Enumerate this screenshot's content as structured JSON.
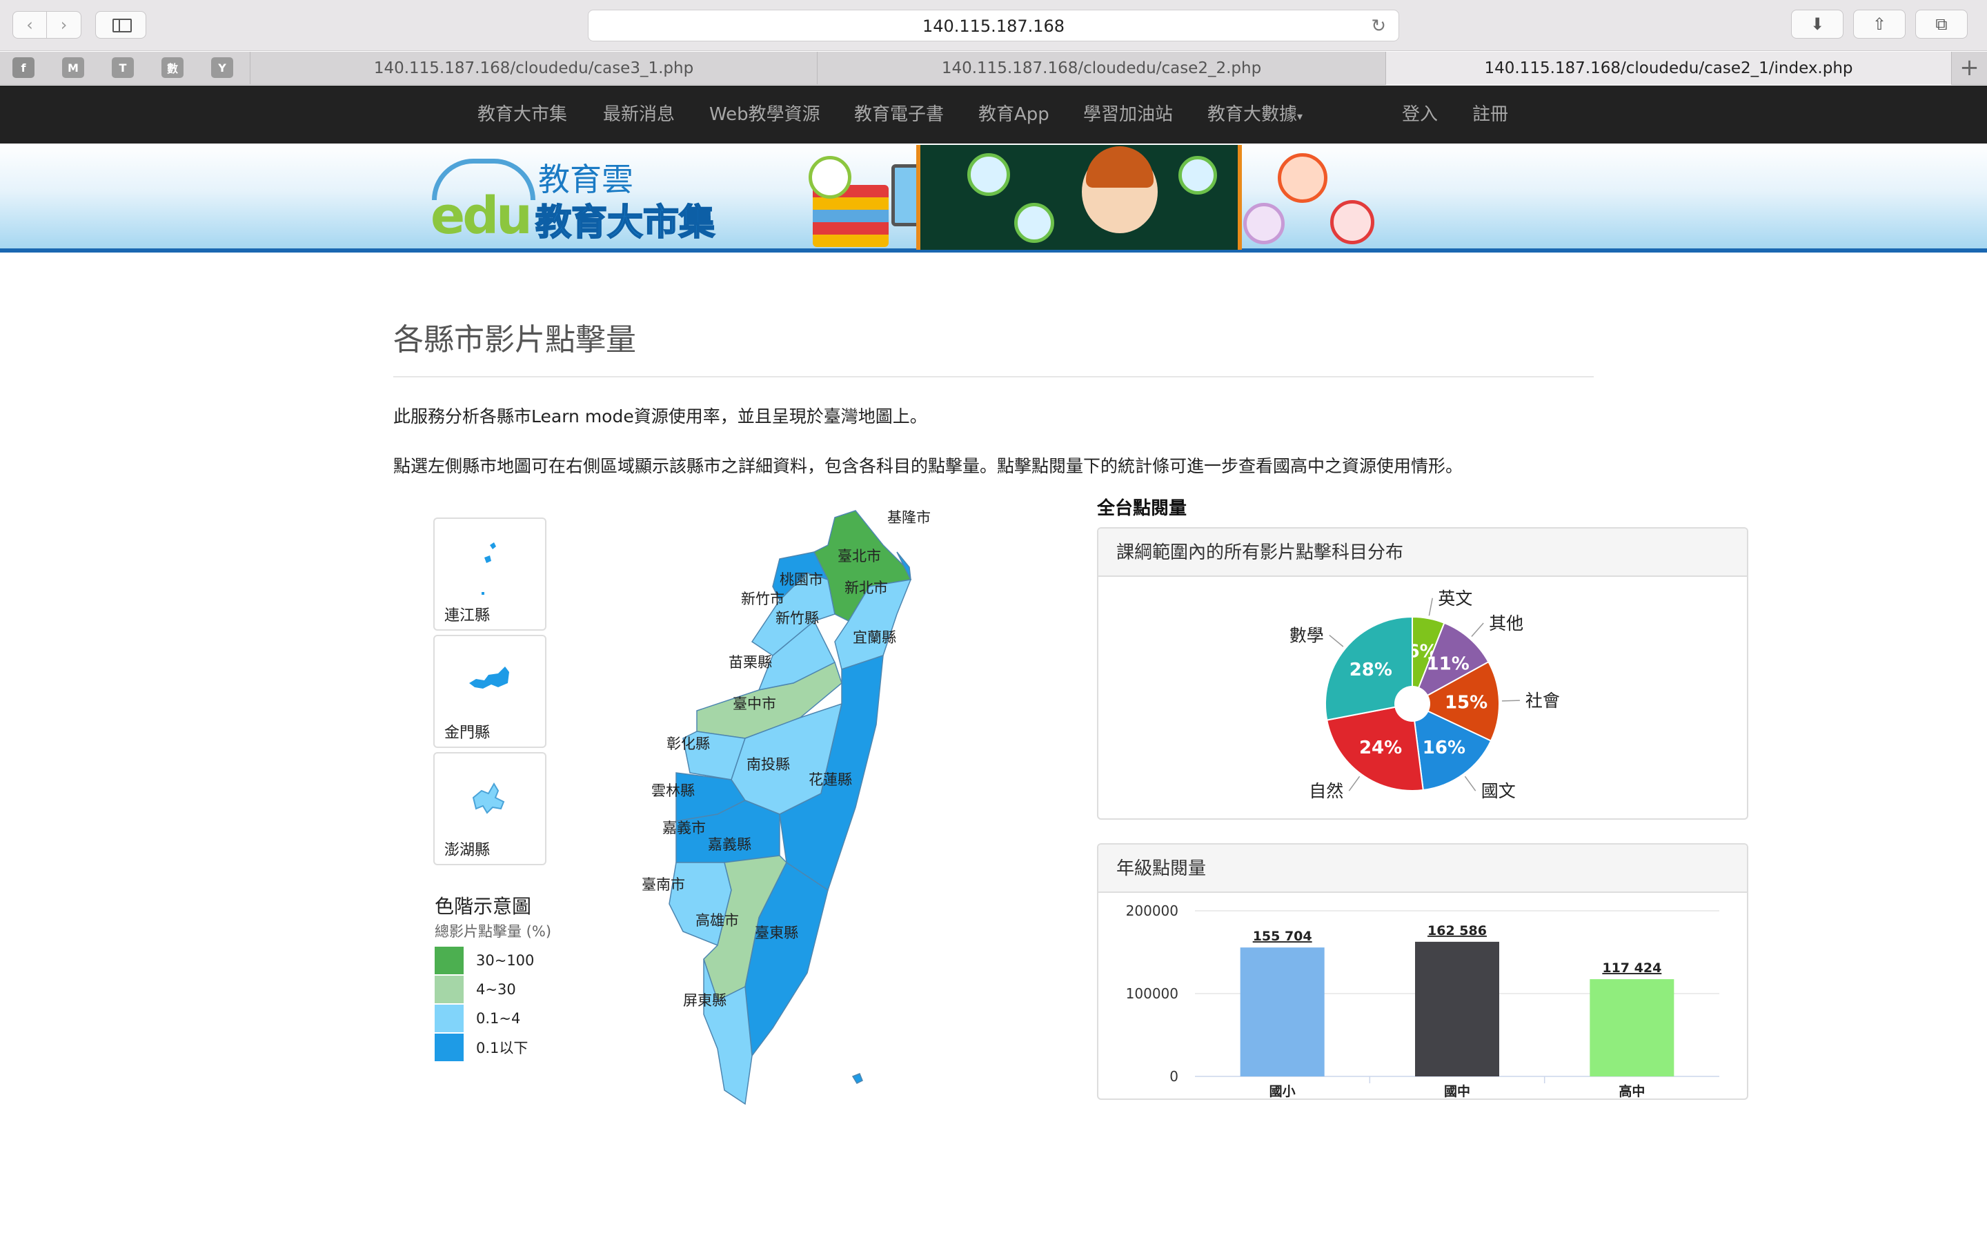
{
  "browser": {
    "address": "140.115.187.168",
    "back_icon": "chevron-left-icon",
    "forward_icon": "chevron-right-icon",
    "favorites": [
      "f",
      "M",
      "T",
      "數",
      "Y"
    ],
    "tabs": [
      {
        "title": "140.115.187.168/cloudedu/case3_1.php",
        "active": false
      },
      {
        "title": "140.115.187.168/cloudedu/case2_2.php",
        "active": false
      },
      {
        "title": "140.115.187.168/cloudedu/case2_1/index.php",
        "active": true
      }
    ],
    "add_tab": "+"
  },
  "site_nav": {
    "items": [
      "教育大市集",
      "最新消息",
      "Web教學資源",
      "教育電子書",
      "教育App",
      "學習加油站",
      "教育大數據"
    ],
    "login": "登入",
    "register": "註冊"
  },
  "banner": {
    "logo_edu": "edu",
    "logo_title1": "教育雲",
    "logo_title2": "教育大市集"
  },
  "page": {
    "title": "各縣市影片點擊量",
    "para1": "此服務分析各縣市Learn mode資源使用率，並且呈現於臺灣地圖上。",
    "para2": "點選左側縣市地圖可在右側區域顯示該縣市之詳細資料，包含各科目的點擊量。點擊點閱量下的統計條可進一步查看國高中之資源使用情形。"
  },
  "map": {
    "islands": [
      "連江縣",
      "金門縣",
      "澎湖縣"
    ],
    "counties": [
      "基隆市",
      "臺北市",
      "桃園市",
      "新北市",
      "新竹市",
      "新竹縣",
      "宜蘭縣",
      "苗栗縣",
      "臺中市",
      "彰化縣",
      "南投縣",
      "花蓮縣",
      "雲林縣",
      "嘉義市",
      "嘉義縣",
      "臺南市",
      "高雄市",
      "臺東縣",
      "屏東縣"
    ],
    "legend_title": "色階示意圖",
    "legend_subtitle": "總影片點擊量 (%)",
    "legend": [
      {
        "label": "30~100",
        "color": "#4caf50"
      },
      {
        "label": "4~30",
        "color": "#a5d6a7"
      },
      {
        "label": "0.1~4",
        "color": "#81d4fa"
      },
      {
        "label": "0.1以下",
        "color": "#1e9be6"
      }
    ]
  },
  "section_title": "全台點閱量",
  "panels": {
    "pie_title": "課綱範圍內的所有影片點擊科目分布",
    "bar_title": "年級點閱量"
  },
  "chart_data": [
    {
      "type": "pie",
      "title": "課綱範圍內的所有影片點擊科目分布",
      "categories": [
        "英文",
        "其他",
        "社會",
        "國文",
        "自然",
        "數學"
      ],
      "values": [
        6,
        11,
        15,
        16,
        24,
        28
      ],
      "value_labels": [
        "6%",
        "11%",
        "15%",
        "16%",
        "24%",
        "28%"
      ],
      "colors": [
        "#7fc41c",
        "#8a5ea8",
        "#d9480f",
        "#1e8bdc",
        "#e0262c",
        "#28b3b0"
      ],
      "donut_hole": true
    },
    {
      "type": "bar",
      "title": "年級點閱量",
      "categories": [
        "國小",
        "國中",
        "高中"
      ],
      "values": [
        155704,
        162586,
        117424
      ],
      "value_labels": [
        "155 704",
        "162 586",
        "117 424"
      ],
      "colors": [
        "#7cb5ec",
        "#434348",
        "#90ed7d"
      ],
      "ylim": [
        0,
        200000
      ],
      "yticks": [
        "0",
        "100000",
        "200000"
      ],
      "grid": true
    }
  ]
}
